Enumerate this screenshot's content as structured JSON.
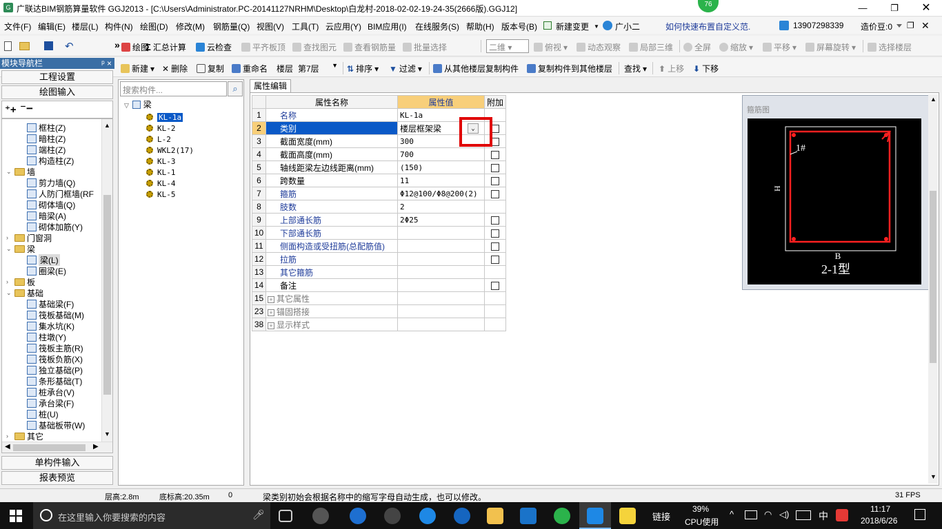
{
  "title": "广联达BIM钢筋算量软件 GGJ2013 - [C:\\Users\\Administrator.PC-20141127NRHM\\Desktop\\白龙村-2018-02-02-19-24-35(2666版).GGJ12]",
  "badge": "76",
  "menu": [
    "文件(F)",
    "编辑(E)",
    "楼层(L)",
    "构件(N)",
    "绘图(D)",
    "修改(M)",
    "钢筋量(Q)",
    "视图(V)",
    "工具(T)",
    "云应用(Y)",
    "BIM应用(I)",
    "在线服务(S)",
    "帮助(H)",
    "版本号(B)",
    "新建变更",
    "广小二",
    "如何快速布置自定义范.",
    "13907298339",
    "造价豆:0"
  ],
  "toolbar1": {
    "draw": "绘图",
    "sum": "汇总计算",
    "cloud_check": "云检查",
    "flush": "平齐板顶",
    "find_elem": "查找图元",
    "view_rebar": "查看钢筋量",
    "batch": "批量选择",
    "view2d": "二维",
    "top": "俯视",
    "dynamic": "动态观察",
    "local3d": "局部三维",
    "fullscreen": "全屏",
    "zoom": "缩放",
    "pan": "平移",
    "rotate": "屏幕旋转",
    "select_floor": "选择楼层"
  },
  "toolbar2": {
    "new": "新建",
    "delete": "删除",
    "copy": "复制",
    "rename": "重命名",
    "floor_label": "楼层",
    "floor_value": "第7层",
    "sort": "排序",
    "filter": "过滤",
    "copy_from": "从其他楼层复制构件",
    "copy_to": "复制构件到其他楼层",
    "find": "查找",
    "up": "上移",
    "down": "下移"
  },
  "nav": {
    "header": "模块导航栏",
    "pin": "ᵖ ×",
    "proj_settings": "工程设置",
    "draw_input": "绘图输入",
    "single_input": "单构件输入",
    "report": "报表预览",
    "tree": [
      {
        "label": "框柱(Z)",
        "kind": "item",
        "level": 2
      },
      {
        "label": "暗柱(Z)",
        "kind": "item",
        "level": 2
      },
      {
        "label": "端柱(Z)",
        "kind": "item",
        "level": 2
      },
      {
        "label": "构造柱(Z)",
        "kind": "item",
        "level": 2
      },
      {
        "label": "墙",
        "kind": "folder",
        "open": true
      },
      {
        "label": "剪力墙(Q)",
        "kind": "item",
        "level": 2
      },
      {
        "label": "人防门框墙(RF",
        "kind": "item",
        "level": 2
      },
      {
        "label": "砌体墙(Q)",
        "kind": "item",
        "level": 2
      },
      {
        "label": "暗梁(A)",
        "kind": "item",
        "level": 2
      },
      {
        "label": "砌体加筋(Y)",
        "kind": "item",
        "level": 2
      },
      {
        "label": "门窗洞",
        "kind": "folder",
        "open": false
      },
      {
        "label": "梁",
        "kind": "folder",
        "open": true
      },
      {
        "label": "梁(L)",
        "kind": "item",
        "level": 2,
        "selected": true
      },
      {
        "label": "圈梁(E)",
        "kind": "item",
        "level": 2
      },
      {
        "label": "板",
        "kind": "folder",
        "open": false
      },
      {
        "label": "基础",
        "kind": "folder",
        "open": true
      },
      {
        "label": "基础梁(F)",
        "kind": "item",
        "level": 2
      },
      {
        "label": "筏板基础(M)",
        "kind": "item",
        "level": 2
      },
      {
        "label": "集水坑(K)",
        "kind": "item",
        "level": 2
      },
      {
        "label": "柱墩(Y)",
        "kind": "item",
        "level": 2
      },
      {
        "label": "筏板主筋(R)",
        "kind": "item",
        "level": 2
      },
      {
        "label": "筏板负筋(X)",
        "kind": "item",
        "level": 2
      },
      {
        "label": "独立基础(P)",
        "kind": "item",
        "level": 2
      },
      {
        "label": "条形基础(T)",
        "kind": "item",
        "level": 2
      },
      {
        "label": "桩承台(V)",
        "kind": "item",
        "level": 2
      },
      {
        "label": "承台梁(F)",
        "kind": "item",
        "level": 2
      },
      {
        "label": "桩(U)",
        "kind": "item",
        "level": 2
      },
      {
        "label": "基础板带(W)",
        "kind": "item",
        "level": 2
      },
      {
        "label": "其它",
        "kind": "folder",
        "open": false
      }
    ]
  },
  "components": {
    "search_placeholder": "搜索构件...",
    "root": "梁",
    "items": [
      "KL-1a",
      "KL-2",
      "L-2",
      "WKL2(17)",
      "KL-3",
      "KL-1",
      "KL-4",
      "KL-5"
    ]
  },
  "property": {
    "tab": "属性编辑",
    "headers": {
      "name": "属性名称",
      "value": "属性值",
      "extra": "附加"
    },
    "rows": [
      {
        "no": "1",
        "name": "名称",
        "value": "KL-1a",
        "check": false,
        "blue": true
      },
      {
        "no": "2",
        "name": "类别",
        "value": "楼层框架梁",
        "check": true,
        "blue": true,
        "selected": true
      },
      {
        "no": "3",
        "name": "截面宽度(mm)",
        "value": "300",
        "check": true,
        "blue": false
      },
      {
        "no": "4",
        "name": "截面高度(mm)",
        "value": "700",
        "check": true,
        "blue": false
      },
      {
        "no": "5",
        "name": "轴线距梁左边线距离(mm)",
        "value": "(150)",
        "check": true,
        "blue": false
      },
      {
        "no": "6",
        "name": "跨数量",
        "value": "11",
        "check": true,
        "blue": false
      },
      {
        "no": "7",
        "name": "箍筋",
        "value": "Φ12@100/Φ8@200(2)",
        "check": true,
        "blue": true
      },
      {
        "no": "8",
        "name": "肢数",
        "value": "2",
        "check": false,
        "blue": true
      },
      {
        "no": "9",
        "name": "上部通长筋",
        "value": "2Φ25",
        "check": true,
        "blue": true
      },
      {
        "no": "10",
        "name": "下部通长筋",
        "value": "",
        "check": true,
        "blue": true
      },
      {
        "no": "11",
        "name": "侧面构造或受扭筋(总配筋值)",
        "value": "",
        "check": true,
        "blue": true
      },
      {
        "no": "12",
        "name": "拉筋",
        "value": "",
        "check": true,
        "blue": true
      },
      {
        "no": "13",
        "name": "其它箍筋",
        "value": "",
        "check": false,
        "blue": true
      },
      {
        "no": "14",
        "name": "备注",
        "value": "",
        "check": true,
        "blue": false
      },
      {
        "no": "15",
        "name": "其它属性",
        "value": "",
        "check": false,
        "group": true
      },
      {
        "no": "23",
        "name": "锚固搭接",
        "value": "",
        "check": false,
        "group": true
      },
      {
        "no": "38",
        "name": "显示样式",
        "value": "",
        "check": false,
        "group": true
      }
    ]
  },
  "stirrup": {
    "title": "箍筋图",
    "label1": "1#",
    "h": "H",
    "b": "B",
    "type": "2-1型"
  },
  "status": {
    "floor_h": "层高:2.8m",
    "base_h": "底标高:20.35m",
    "zero": "0",
    "hint": "梁类别初始会根据名称中的缩写字母自动生成，也可以修改。",
    "fps": "31 FPS"
  },
  "taskbar": {
    "search": "在这里输入你要搜索的内容",
    "links": "链接",
    "cpu": "39%",
    "cpu_label": "CPU使用",
    "ime": "中",
    "time": "11:17",
    "date": "2018/6/26"
  },
  "colors": {
    "accent": "#0a59c7",
    "header_value": "#f8cf7a",
    "highlight": "#e00000",
    "stirrup": "#ff2020"
  }
}
